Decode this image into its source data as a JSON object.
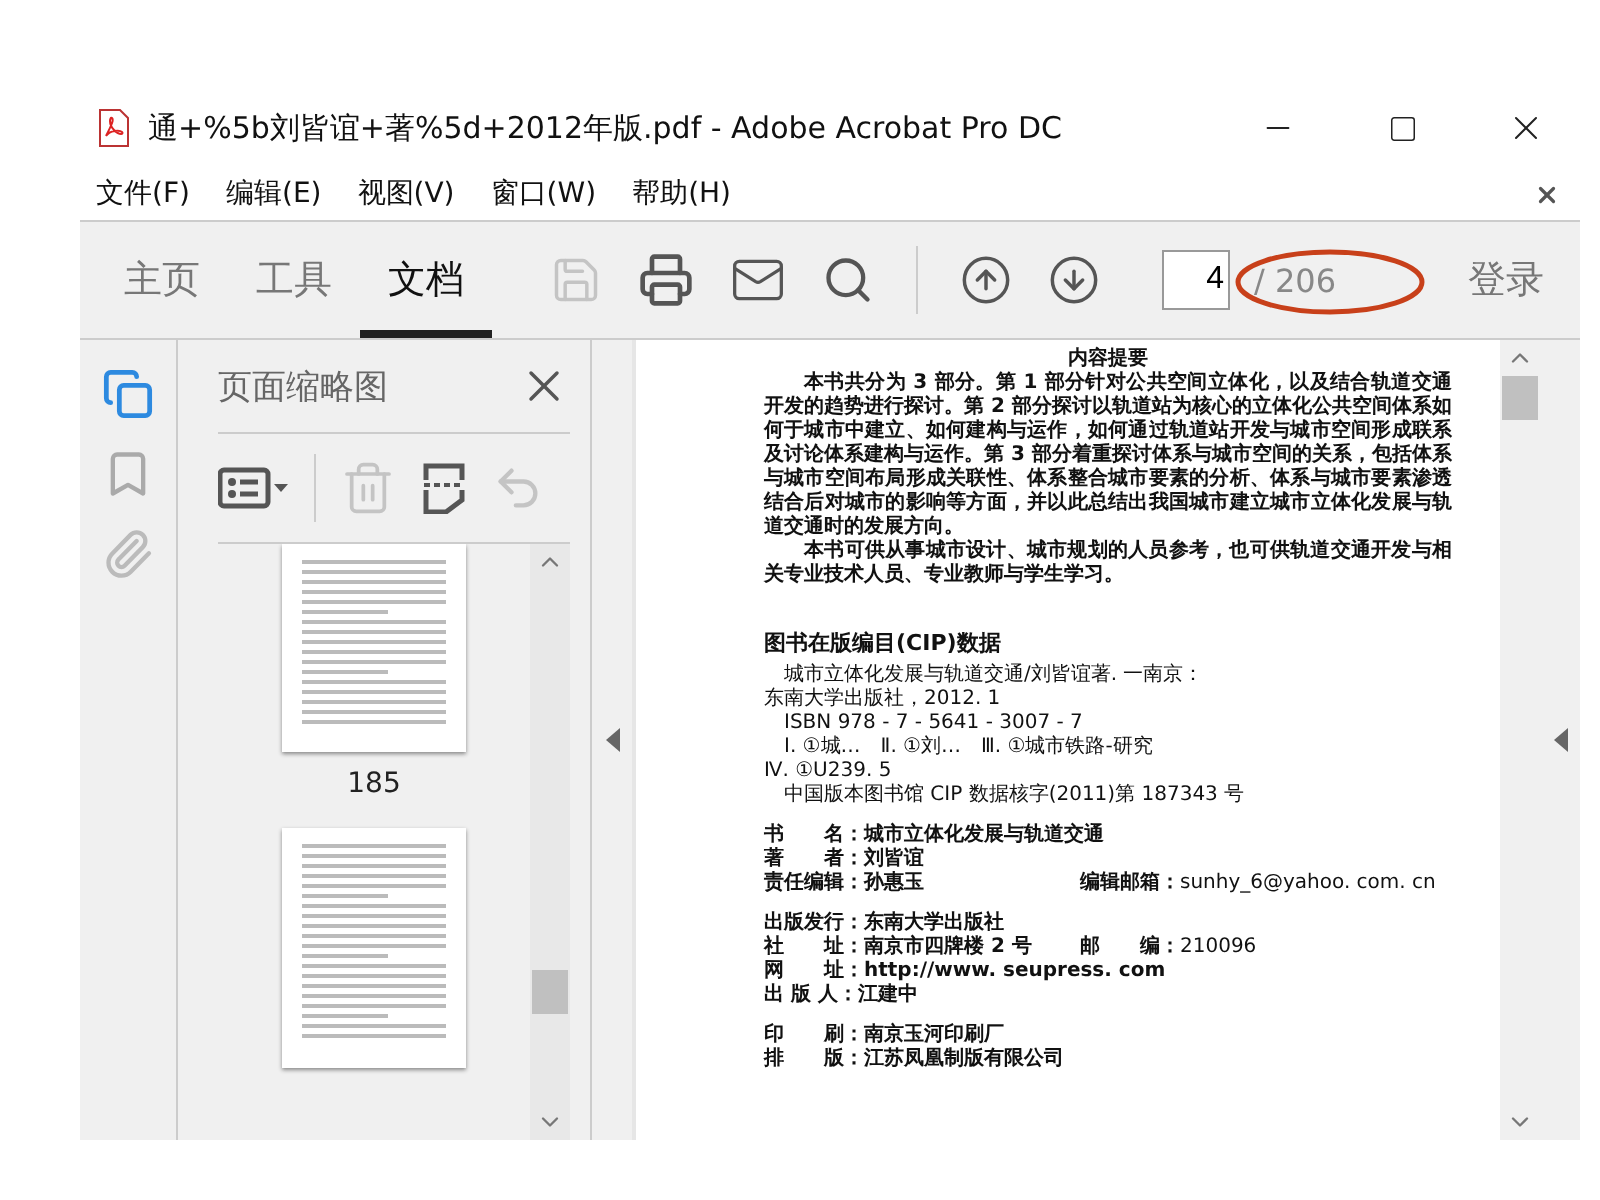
{
  "window": {
    "title": "通+%5b刘皆谊+著%5d+2012年版.pdf - Adobe Acrobat Pro DC"
  },
  "menu": [
    "文件(F)",
    "编辑(E)",
    "视图(V)",
    "窗口(W)",
    "帮助(H)"
  ],
  "toolbar": {
    "tabs": [
      {
        "label": "主页",
        "selected": false
      },
      {
        "label": "工具",
        "selected": false
      },
      {
        "label": "文档",
        "selected": true
      }
    ],
    "page_number": "4",
    "page_total": "/ 206",
    "sign_in": "登录"
  },
  "thumbnail_panel": {
    "title": "页面缩略图",
    "thumbnails": [
      {
        "label": "185"
      }
    ]
  },
  "document": [
    {
      "kind": "title",
      "text": "内容提要"
    },
    {
      "kind": "paragraph",
      "text": "本书共分为 3 部分。第 1 部分针对公共空间立体化，以及结合轨道交通开发的趋势进行探讨。第 2 部分探讨以轨道站为核心的立体化公共空间体系如何于城市中建立、如何建构与运作，如何通过轨道站开发与城市空间形成联系及讨论体系建构与运作。第 3 部分着重探讨体系与城市空间的关系，包括体系与城市空间布局形成关联性、体系整合城市要素的分析、体系与城市要素渗透结合后对城市的影响等方面，并以此总结出我国城市建立城市立体化发展与轨道交通时的发展方向。"
    },
    {
      "kind": "paragraph",
      "text": "本书可供从事城市设计、城市规划的人员参考，也可供轨道交通开发与相关专业技术人员、专业教师与学生学习。"
    },
    {
      "kind": "heading",
      "text": "图书在版编目(CIP)数据"
    },
    {
      "kind": "indent",
      "text": "城市立体化发展与轨道交通/刘皆谊著. 一南京："
    },
    {
      "kind": "line",
      "text": "东南大学出版社，2012. 1"
    },
    {
      "kind": "indent",
      "text": "ISBN 978 - 7 - 5641 - 3007 - 7"
    },
    {
      "kind": "indent",
      "text": "Ⅰ. ①城…　Ⅱ. ①刘…　Ⅲ. ①城市铁路-研究"
    },
    {
      "kind": "line",
      "text": "Ⅳ. ①U239. 5"
    },
    {
      "kind": "indent",
      "text": "中国版本图书馆 CIP 数据核字(2011)第 187343 号"
    },
    {
      "kind": "field",
      "label": "书　　名：",
      "value": "城市立体化发展与轨道交通"
    },
    {
      "kind": "field",
      "label": "著　　者：",
      "value": "刘皆谊"
    },
    {
      "kind": "field",
      "label": "责任编辑：",
      "value": "孙惠玉",
      "label2": "编辑邮箱：",
      "value2": "sunhy_6@yahoo. com. cn"
    },
    {
      "kind": "field",
      "label": "出版发行：",
      "value": "东南大学出版社"
    },
    {
      "kind": "field",
      "label": "社　　址：",
      "value": "南京市四牌楼 2 号",
      "label2": "邮　　编：",
      "value2": "210096"
    },
    {
      "kind": "field",
      "label": "网　　址：",
      "value": "http://www. seupress. com"
    },
    {
      "kind": "field",
      "label": "出 版 人：",
      "value": "江建中"
    },
    {
      "kind": "field",
      "label": "印　　刷：",
      "value": "南京玉河印刷厂"
    },
    {
      "kind": "field",
      "label": "排　　版：",
      "value": "江苏凤凰制版有限公司"
    }
  ]
}
